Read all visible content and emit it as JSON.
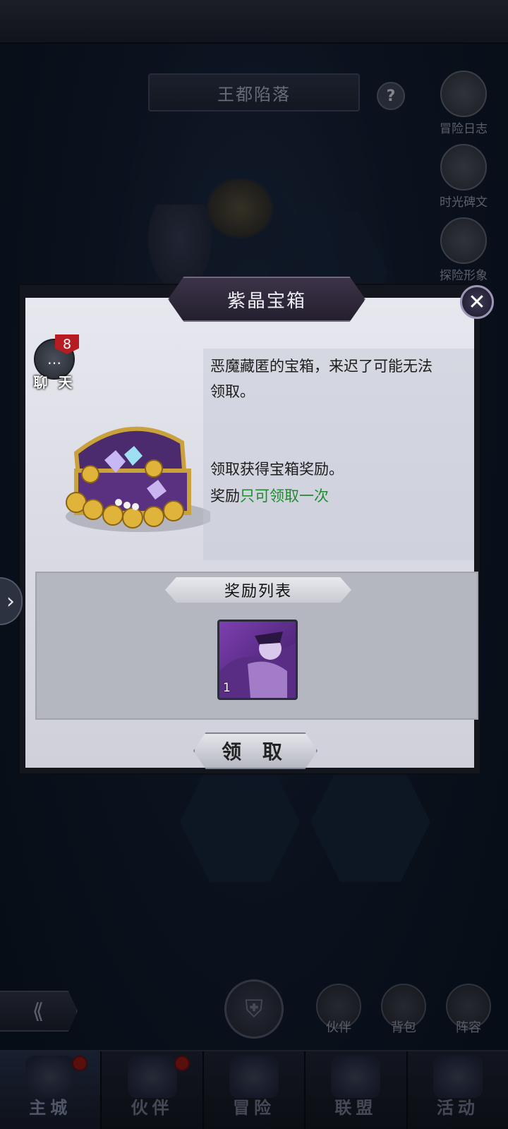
{
  "chapter": {
    "title": "王都陷落"
  },
  "side_menu": [
    {
      "label": "冒险日志"
    },
    {
      "label": "时光碑文"
    },
    {
      "label": "探险形象"
    }
  ],
  "chat": {
    "label": "聊 天",
    "badge": "8"
  },
  "dialog": {
    "title": "紫晶宝箱",
    "desc_line1": "恶魔藏匿的宝箱，来迟了可能无法",
    "desc_line2": "领取。",
    "desc_line3": "领取获得宝箱奖励。",
    "desc_line4_prefix": "奖励",
    "desc_line4_highlight": "只可领取一次",
    "reward_header": "奖励列表",
    "reward_items": [
      {
        "qty": "1"
      }
    ],
    "claim_label": "领 取"
  },
  "hud": {
    "buttons": [
      {
        "label": "伙伴"
      },
      {
        "label": "背包"
      },
      {
        "label": "阵容"
      }
    ]
  },
  "bottom_nav": [
    {
      "label": "主城"
    },
    {
      "label": "伙伴"
    },
    {
      "label": "冒险"
    },
    {
      "label": "联盟"
    },
    {
      "label": "活动"
    }
  ]
}
